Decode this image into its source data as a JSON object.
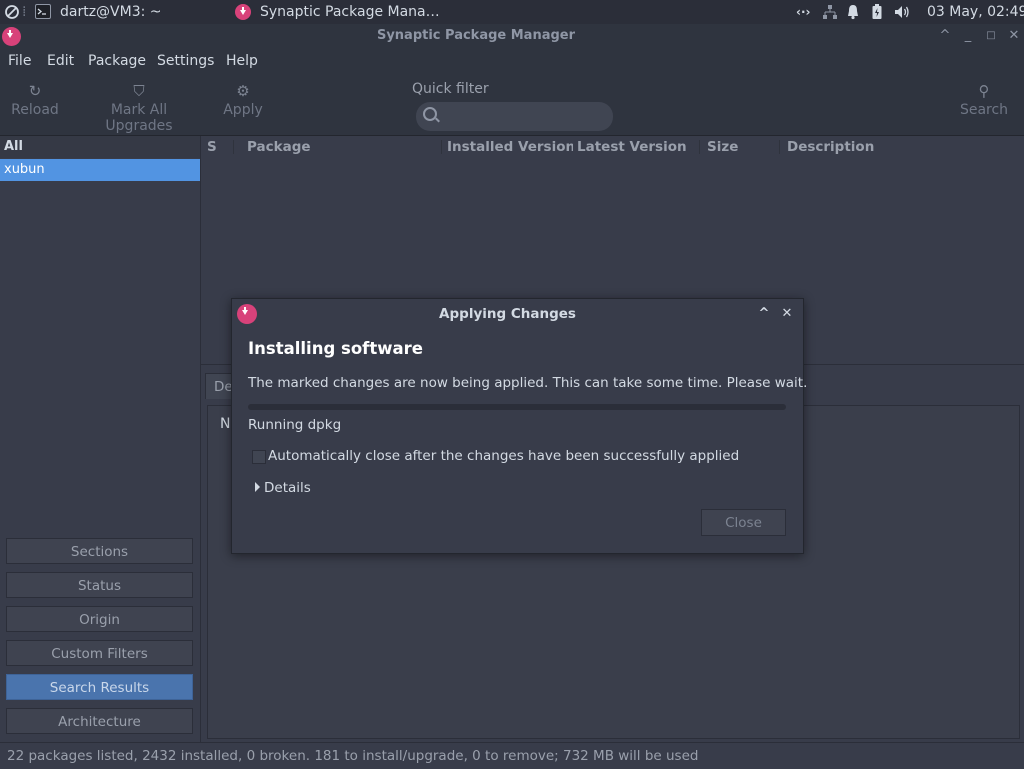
{
  "top_panel": {
    "terminal_task": "dartz@VM3: ~",
    "synaptic_task": "Synaptic Package Mana…",
    "clock": "03 May, 02:49"
  },
  "window": {
    "title": "Synaptic Package Manager"
  },
  "menubar": {
    "items": [
      "File",
      "Edit",
      "Package",
      "Settings",
      "Help"
    ]
  },
  "toolbar": {
    "reload": "Reload",
    "mark_all_upgrades": "Mark All Upgrades",
    "apply": "Apply",
    "quick_filter_label": "Quick filter",
    "quick_filter_value": "",
    "search": "Search"
  },
  "left_pane": {
    "header": "All",
    "selected_item": "xubun",
    "filter_buttons": [
      "Sections",
      "Status",
      "Origin",
      "Custom Filters",
      "Search Results",
      "Architecture"
    ],
    "active_filter": "Search Results"
  },
  "package_list": {
    "columns": [
      "S",
      "Package",
      "Installed Version",
      "Latest Version",
      "Size",
      "Description"
    ]
  },
  "details": {
    "tab_label": "De",
    "content_stub": "N"
  },
  "statusbar": {
    "text": "22 packages listed, 2432 installed, 0 broken. 181 to install/upgrade, 0 to remove; 732 MB will be used"
  },
  "dialog": {
    "title": "Applying Changes",
    "heading": "Installing software",
    "description": "The marked changes are now being applied. This can take some time. Please wait.",
    "progress": 0.0,
    "step": "Running dpkg",
    "auto_close_label": "Automatically close after the changes have been successfully applied",
    "auto_close_checked": false,
    "details_label": "Details",
    "close_label": "Close"
  },
  "colors": {
    "accent": "#5294e2",
    "app_icon": "#d8427a",
    "background": "#383c4a",
    "panel": "#2b2e39"
  }
}
